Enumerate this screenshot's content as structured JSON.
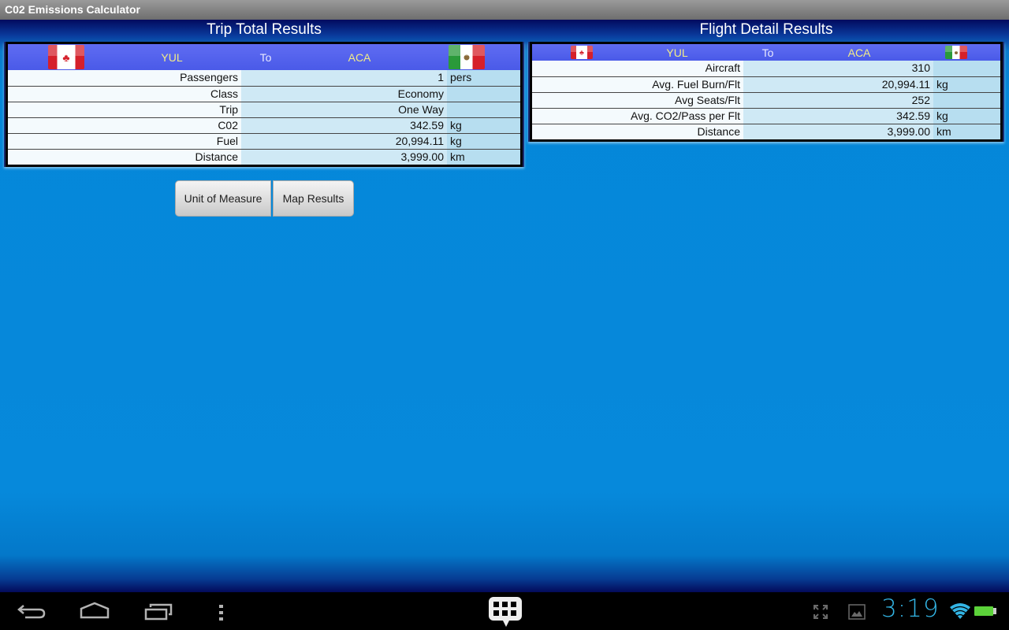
{
  "app": {
    "title": "C02 Emissions Calculator"
  },
  "trip_total": {
    "title": "Trip Total Results",
    "header": {
      "origin_flag": "canada-flag",
      "origin": "YUL",
      "to": "To",
      "destination": "ACA",
      "destination_flag": "mexico-flag"
    },
    "rows": [
      {
        "label": "Passengers",
        "value": "1",
        "unit": "pers"
      },
      {
        "label": "Class",
        "value": "Economy",
        "unit": ""
      },
      {
        "label": "Trip",
        "value": "One Way",
        "unit": ""
      },
      {
        "label": "C02",
        "value": "342.59",
        "unit": "kg"
      },
      {
        "label": "Fuel",
        "value": "20,994.11",
        "unit": "kg"
      },
      {
        "label": "Distance",
        "value": "3,999.00",
        "unit": "km"
      }
    ]
  },
  "flight_detail": {
    "title": "Flight Detail Results",
    "header": {
      "origin_flag": "canada-flag",
      "origin": "YUL",
      "to": "To",
      "destination": "ACA",
      "destination_flag": "mexico-flag"
    },
    "rows": [
      {
        "label": "Aircraft",
        "value": "310",
        "unit": ""
      },
      {
        "label": "Avg. Fuel Burn/Flt",
        "value": "20,994.11",
        "unit": "kg"
      },
      {
        "label": "Avg Seats/Flt",
        "value": "252",
        "unit": ""
      },
      {
        "label": "Avg. CO2/Pass per Flt",
        "value": "342.59",
        "unit": "kg"
      },
      {
        "label": "Distance",
        "value": "3,999.00",
        "unit": "km"
      }
    ]
  },
  "buttons": {
    "unit_of_measure": "Unit of Measure",
    "map_results": "Map Results"
  },
  "system_bar": {
    "icons": [
      "back-icon",
      "home-icon",
      "recent-apps-icon",
      "menu-icon",
      "app-drawer-icon",
      "fullscreen-icon",
      "gallery-icon",
      "wifi-icon",
      "battery-icon"
    ],
    "clock": "3:19",
    "accent_color": "#33b5e5"
  },
  "colors": {
    "header_bar": "#5060ec",
    "header_text": "#f2ec88",
    "label_cell": "#f4fafd",
    "value_cell": "#cfe9f5",
    "unit_cell": "#b7def0"
  }
}
